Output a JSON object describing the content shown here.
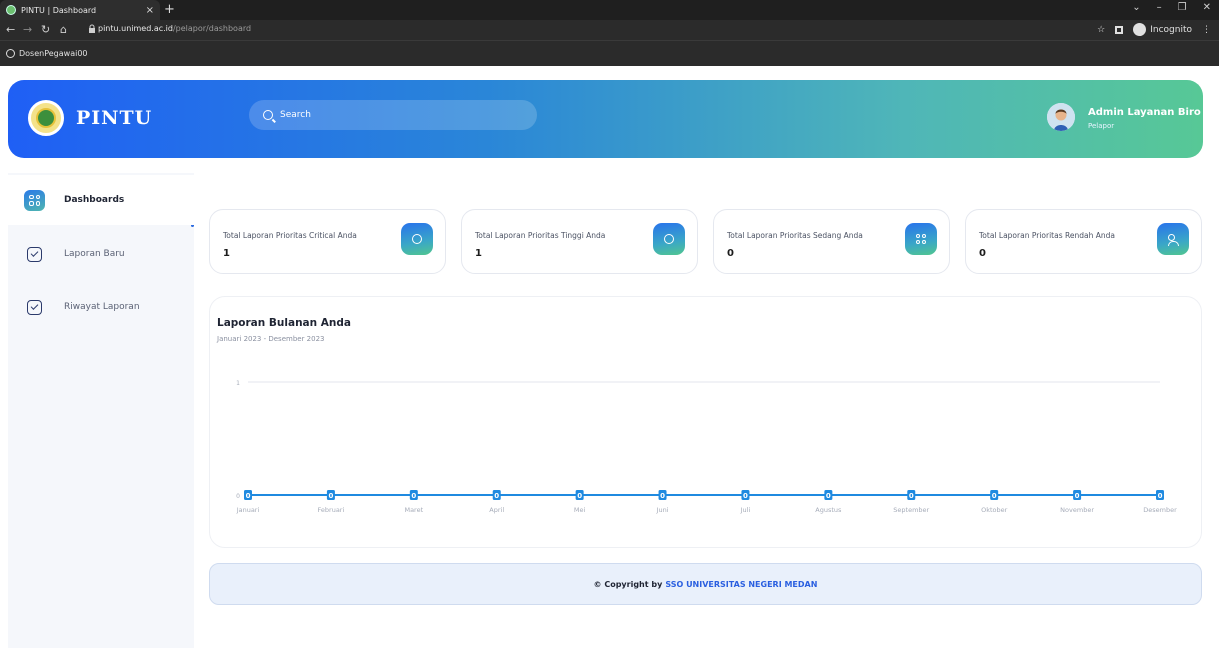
{
  "browser": {
    "tab_title": "PINTU | Dashboard",
    "tab_close": "×",
    "new_tab": "+",
    "url_host": "pintu.unimed.ac.id",
    "url_path": "/pelapor/dashboard",
    "incognito_label": "Incognito",
    "profile_label": "DosenPegawai00",
    "window_controls": [
      "⌄",
      "–",
      "❐",
      "✕"
    ]
  },
  "header": {
    "brand": "PINTU",
    "search_placeholder": "Search",
    "user_name": "Admin Layanan Biro",
    "user_role": "Pelapor"
  },
  "sidebar": {
    "items": [
      {
        "label": "Dashboards",
        "icon": "dashboard-icon",
        "active": true
      },
      {
        "label": "Laporan Baru",
        "icon": "inbox-icon",
        "active": false
      },
      {
        "label": "Riwayat Laporan",
        "icon": "inbox-icon",
        "active": false
      }
    ]
  },
  "cards": [
    {
      "label": "Total Laporan Prioritas Critical Anda",
      "value": "1",
      "icon": "fingerprint-icon"
    },
    {
      "label": "Total Laporan Prioritas Tinggi Anda",
      "value": "1",
      "icon": "user-circle-icon"
    },
    {
      "label": "Total Laporan Prioritas Sedang Anda",
      "value": "0",
      "icon": "nodes-icon"
    },
    {
      "label": "Total Laporan Prioritas Rendah Anda",
      "value": "0",
      "icon": "users-icon"
    }
  ],
  "chart_data": {
    "type": "line",
    "title": "Laporan Bulanan Anda",
    "subtitle": "Januari 2023 - Desember 2023",
    "categories": [
      "Januari",
      "Februari",
      "Maret",
      "April",
      "Mei",
      "Juni",
      "Juli",
      "Agustus",
      "September",
      "Oktober",
      "November",
      "Desember"
    ],
    "values": [
      0,
      0,
      0,
      0,
      0,
      0,
      0,
      0,
      0,
      0,
      0,
      0
    ],
    "y_ticks": [
      "0",
      "1"
    ],
    "ylim": [
      0,
      1
    ],
    "color": "#1f8ae0"
  },
  "footer": {
    "prefix": "© Copyright by",
    "org": "SSO UNIVERSITAS NEGERI MEDAN"
  }
}
